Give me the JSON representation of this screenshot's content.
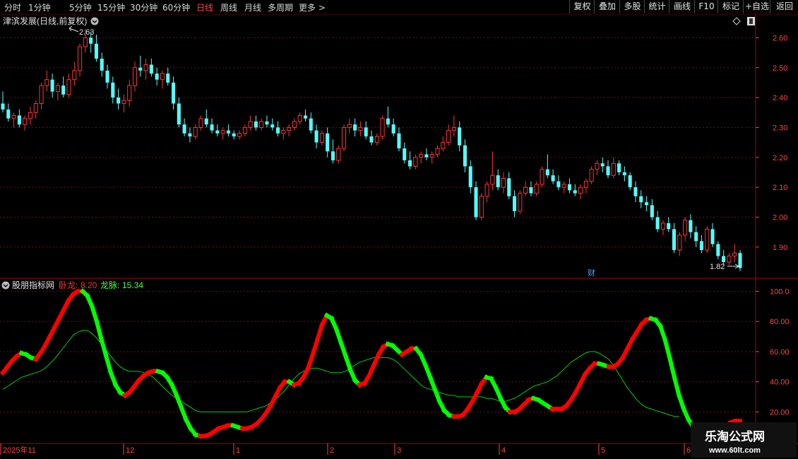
{
  "toolbar": {
    "timeframes": [
      "分时",
      "1分钟",
      "5分钟",
      "15分钟",
      "30分钟",
      "60分钟",
      "日线",
      "周线",
      "月线",
      "多周期",
      "更多 >"
    ],
    "active_index": 6,
    "buttons": [
      "复权",
      "叠加",
      "多股",
      "统计",
      "画线",
      "F10",
      "标记",
      "+自选",
      "返回"
    ]
  },
  "main_chart": {
    "title": "津滨发展(日线,前复权)",
    "high_label": "2.63",
    "low_label": "1.82",
    "finance_marker": "财"
  },
  "indicator": {
    "name": "股朋指标网",
    "wolong_label": "卧龙:",
    "wolong_value": "8.20",
    "longmai_label": "龙脉:",
    "longmai_value": "15.34"
  },
  "watermark": {
    "title": "乐淘公式网",
    "url": "www.60lt.com"
  },
  "colors": {
    "up": "#ff3232",
    "down": "#54ffff",
    "grid": "#8b0000",
    "axis_text": "#ff4040",
    "rising": "#ff0000",
    "falling": "#00ff00",
    "ma_line": "#00d000"
  },
  "chart_data": [
    {
      "type": "candlestick",
      "title": "津滨发展(日线,前复权)",
      "y_ticks": [
        "2.60",
        "2.50",
        "2.40",
        "2.30",
        "2.20",
        "2.10",
        "2.00",
        "1.90"
      ],
      "ylim": [
        1.81,
        2.66
      ],
      "x_labels": [
        "2025年11",
        "12",
        "1",
        "2",
        "3",
        "4",
        "5",
        "6"
      ],
      "candles": [
        [
          2.38,
          2.42,
          2.35,
          2.36
        ],
        [
          2.36,
          2.38,
          2.32,
          2.33
        ],
        [
          2.33,
          2.35,
          2.3,
          2.34
        ],
        [
          2.34,
          2.36,
          2.3,
          2.31
        ],
        [
          2.31,
          2.34,
          2.29,
          2.33
        ],
        [
          2.33,
          2.37,
          2.31,
          2.35
        ],
        [
          2.35,
          2.39,
          2.33,
          2.38
        ],
        [
          2.38,
          2.45,
          2.36,
          2.44
        ],
        [
          2.44,
          2.49,
          2.42,
          2.46
        ],
        [
          2.46,
          2.48,
          2.4,
          2.42
        ],
        [
          2.42,
          2.45,
          2.39,
          2.44
        ],
        [
          2.44,
          2.47,
          2.4,
          2.41
        ],
        [
          2.41,
          2.48,
          2.4,
          2.46
        ],
        [
          2.46,
          2.52,
          2.44,
          2.49
        ],
        [
          2.49,
          2.58,
          2.47,
          2.57
        ],
        [
          2.57,
          2.63,
          2.55,
          2.6
        ],
        [
          2.6,
          2.62,
          2.55,
          2.58
        ],
        [
          2.58,
          2.61,
          2.52,
          2.53
        ],
        [
          2.53,
          2.55,
          2.47,
          2.49
        ],
        [
          2.49,
          2.51,
          2.43,
          2.45
        ],
        [
          2.45,
          2.47,
          2.38,
          2.4
        ],
        [
          2.4,
          2.43,
          2.36,
          2.38
        ],
        [
          2.38,
          2.41,
          2.35,
          2.39
        ],
        [
          2.39,
          2.46,
          2.37,
          2.44
        ],
        [
          2.44,
          2.52,
          2.42,
          2.5
        ],
        [
          2.5,
          2.54,
          2.47,
          2.49
        ],
        [
          2.49,
          2.53,
          2.46,
          2.51
        ],
        [
          2.51,
          2.53,
          2.47,
          2.48
        ],
        [
          2.48,
          2.5,
          2.44,
          2.46
        ],
        [
          2.46,
          2.49,
          2.43,
          2.48
        ],
        [
          2.48,
          2.5,
          2.44,
          2.45
        ],
        [
          2.45,
          2.47,
          2.36,
          2.38
        ],
        [
          2.38,
          2.4,
          2.3,
          2.31
        ],
        [
          2.31,
          2.33,
          2.27,
          2.28
        ],
        [
          2.28,
          2.3,
          2.25,
          2.27
        ],
        [
          2.27,
          2.31,
          2.26,
          2.3
        ],
        [
          2.3,
          2.34,
          2.29,
          2.33
        ],
        [
          2.33,
          2.36,
          2.3,
          2.31
        ],
        [
          2.31,
          2.33,
          2.28,
          2.29
        ],
        [
          2.29,
          2.31,
          2.27,
          2.28
        ],
        [
          2.28,
          2.3,
          2.26,
          2.29
        ],
        [
          2.29,
          2.31,
          2.27,
          2.28
        ],
        [
          2.28,
          2.29,
          2.26,
          2.27
        ],
        [
          2.27,
          2.29,
          2.26,
          2.28
        ],
        [
          2.28,
          2.31,
          2.27,
          2.3
        ],
        [
          2.3,
          2.34,
          2.29,
          2.32
        ],
        [
          2.32,
          2.34,
          2.29,
          2.3
        ],
        [
          2.3,
          2.33,
          2.29,
          2.32
        ],
        [
          2.32,
          2.34,
          2.3,
          2.31
        ],
        [
          2.31,
          2.33,
          2.29,
          2.3
        ],
        [
          2.3,
          2.32,
          2.27,
          2.28
        ],
        [
          2.28,
          2.3,
          2.26,
          2.29
        ],
        [
          2.29,
          2.31,
          2.27,
          2.3
        ],
        [
          2.3,
          2.33,
          2.29,
          2.32
        ],
        [
          2.32,
          2.35,
          2.31,
          2.34
        ],
        [
          2.34,
          2.36,
          2.32,
          2.33
        ],
        [
          2.33,
          2.35,
          2.28,
          2.29
        ],
        [
          2.29,
          2.31,
          2.23,
          2.25
        ],
        [
          2.25,
          2.29,
          2.24,
          2.28
        ],
        [
          2.28,
          2.3,
          2.2,
          2.22
        ],
        [
          2.22,
          2.26,
          2.18,
          2.19
        ],
        [
          2.19,
          2.24,
          2.18,
          2.23
        ],
        [
          2.23,
          2.31,
          2.22,
          2.3
        ],
        [
          2.3,
          2.33,
          2.28,
          2.31
        ],
        [
          2.31,
          2.33,
          2.27,
          2.29
        ],
        [
          2.29,
          2.32,
          2.27,
          2.3
        ],
        [
          2.3,
          2.32,
          2.26,
          2.27
        ],
        [
          2.27,
          2.29,
          2.24,
          2.25
        ],
        [
          2.25,
          2.28,
          2.24,
          2.27
        ],
        [
          2.27,
          2.34,
          2.26,
          2.33
        ],
        [
          2.33,
          2.37,
          2.3,
          2.31
        ],
        [
          2.31,
          2.33,
          2.27,
          2.28
        ],
        [
          2.28,
          2.3,
          2.22,
          2.23
        ],
        [
          2.23,
          2.25,
          2.18,
          2.19
        ],
        [
          2.19,
          2.22,
          2.16,
          2.17
        ],
        [
          2.17,
          2.21,
          2.16,
          2.2
        ],
        [
          2.2,
          2.22,
          2.18,
          2.21
        ],
        [
          2.21,
          2.23,
          2.19,
          2.2
        ],
        [
          2.2,
          2.22,
          2.18,
          2.21
        ],
        [
          2.21,
          2.24,
          2.2,
          2.23
        ],
        [
          2.23,
          2.27,
          2.22,
          2.25
        ],
        [
          2.25,
          2.31,
          2.24,
          2.29
        ],
        [
          2.29,
          2.34,
          2.27,
          2.3
        ],
        [
          2.3,
          2.32,
          2.22,
          2.24
        ],
        [
          2.24,
          2.26,
          2.15,
          2.17
        ],
        [
          2.17,
          2.19,
          2.08,
          2.1
        ],
        [
          2.1,
          2.12,
          1.99,
          2.0
        ],
        [
          2.0,
          2.08,
          1.99,
          2.07
        ],
        [
          2.07,
          2.12,
          2.05,
          2.11
        ],
        [
          2.11,
          2.22,
          2.09,
          2.14
        ],
        [
          2.14,
          2.16,
          2.09,
          2.1
        ],
        [
          2.1,
          2.15,
          2.08,
          2.13
        ],
        [
          2.13,
          2.15,
          2.06,
          2.07
        ],
        [
          2.07,
          2.09,
          2.0,
          2.02
        ],
        [
          2.02,
          2.09,
          2.01,
          2.08
        ],
        [
          2.08,
          2.12,
          2.07,
          2.1
        ],
        [
          2.1,
          2.12,
          2.07,
          2.08
        ],
        [
          2.08,
          2.12,
          2.07,
          2.11
        ],
        [
          2.11,
          2.17,
          2.1,
          2.16
        ],
        [
          2.16,
          2.21,
          2.13,
          2.14
        ],
        [
          2.14,
          2.16,
          2.11,
          2.12
        ],
        [
          2.12,
          2.14,
          2.09,
          2.1
        ],
        [
          2.1,
          2.12,
          2.08,
          2.11
        ],
        [
          2.11,
          2.13,
          2.08,
          2.09
        ],
        [
          2.09,
          2.11,
          2.07,
          2.08
        ],
        [
          2.08,
          2.11,
          2.06,
          2.1
        ],
        [
          2.1,
          2.13,
          2.08,
          2.12
        ],
        [
          2.12,
          2.17,
          2.11,
          2.16
        ],
        [
          2.16,
          2.19,
          2.14,
          2.18
        ],
        [
          2.18,
          2.2,
          2.15,
          2.17
        ],
        [
          2.17,
          2.19,
          2.13,
          2.14
        ],
        [
          2.14,
          2.2,
          2.13,
          2.18
        ],
        [
          2.18,
          2.19,
          2.14,
          2.15
        ],
        [
          2.15,
          2.17,
          2.12,
          2.14
        ],
        [
          2.14,
          2.15,
          2.09,
          2.1
        ],
        [
          2.1,
          2.12,
          2.05,
          2.07
        ],
        [
          2.07,
          2.09,
          2.03,
          2.05
        ],
        [
          2.05,
          2.07,
          2.02,
          2.04
        ],
        [
          2.04,
          2.06,
          1.99,
          2.0
        ],
        [
          2.0,
          2.02,
          1.95,
          1.96
        ],
        [
          1.96,
          1.99,
          1.94,
          1.98
        ],
        [
          1.98,
          2.0,
          1.95,
          1.96
        ],
        [
          1.96,
          1.98,
          1.88,
          1.89
        ],
        [
          1.89,
          1.95,
          1.87,
          1.94
        ],
        [
          1.94,
          2.0,
          1.92,
          1.99
        ],
        [
          1.99,
          2.01,
          1.93,
          1.95
        ],
        [
          1.95,
          1.97,
          1.9,
          1.92
        ],
        [
          1.92,
          1.94,
          1.88,
          1.89
        ],
        [
          1.89,
          1.97,
          1.88,
          1.96
        ],
        [
          1.96,
          1.98,
          1.9,
          1.91
        ],
        [
          1.91,
          1.92,
          1.86,
          1.87
        ],
        [
          1.87,
          1.89,
          1.84,
          1.85
        ],
        [
          1.85,
          1.88,
          1.84,
          1.87
        ],
        [
          1.87,
          1.91,
          1.85,
          1.88
        ],
        [
          1.88,
          1.89,
          1.82,
          1.83
        ]
      ]
    },
    {
      "type": "line",
      "title": "股朋指标网",
      "y_ticks": [
        "100.0",
        "80.00",
        "60.00",
        "40.00",
        "20.00"
      ],
      "ylim": [
        0,
        104
      ],
      "series": [
        {
          "name": "卧龙",
          "values": [
            46,
            50,
            54,
            57,
            59,
            58,
            56,
            55,
            59,
            64,
            70,
            76,
            82,
            88,
            94,
            98,
            100,
            100,
            97,
            90,
            80,
            68,
            57,
            46,
            38,
            33,
            31,
            33,
            37,
            41,
            44,
            46,
            47,
            47,
            46,
            43,
            38,
            31,
            23,
            15,
            9,
            5,
            4,
            4,
            5,
            7,
            9,
            10,
            11,
            11,
            10,
            9,
            9,
            10,
            12,
            15,
            19,
            24,
            30,
            36,
            40,
            40,
            38,
            39,
            43,
            49,
            58,
            68,
            78,
            84,
            82,
            75,
            66,
            57,
            48,
            41,
            38,
            39,
            44,
            51,
            58,
            63,
            65,
            64,
            61,
            58,
            60,
            62,
            62,
            58,
            51,
            43,
            35,
            27,
            21,
            18,
            17,
            17,
            18,
            22,
            27,
            33,
            39,
            43,
            42,
            36,
            29,
            23,
            20,
            20,
            22,
            25,
            28,
            29,
            28,
            26,
            24,
            22,
            22,
            22,
            24,
            28,
            33,
            39,
            45,
            49,
            52,
            52,
            51,
            50,
            50,
            52,
            56,
            62,
            68,
            73,
            78,
            81,
            82,
            81,
            77,
            68,
            56,
            43,
            31,
            22,
            15,
            10,
            7,
            5,
            4,
            4,
            5,
            8,
            11,
            13,
            14,
            14
          ]
        },
        {
          "name": "龙脉",
          "values": [
            35,
            37,
            39,
            41,
            43,
            44,
            45,
            46,
            47,
            49,
            52,
            55,
            59,
            63,
            67,
            71,
            73,
            74,
            74,
            72,
            69,
            65,
            61,
            57,
            53,
            50,
            48,
            47,
            47,
            47,
            46,
            45,
            43,
            40,
            37,
            34,
            31,
            29,
            27,
            25,
            23,
            21,
            20,
            20,
            20,
            20,
            20,
            20,
            20,
            20,
            20,
            20,
            20,
            21,
            22,
            23,
            24,
            26,
            28,
            31,
            34,
            38,
            42,
            45,
            47,
            48,
            49,
            49,
            48,
            47,
            46,
            46,
            46,
            47,
            49,
            51,
            53,
            54,
            55,
            56,
            56,
            56,
            56,
            55,
            53,
            50,
            47,
            44,
            41,
            38,
            36,
            35,
            34,
            33,
            32,
            31,
            31,
            30,
            30,
            30,
            30,
            30,
            30,
            29,
            29,
            28,
            27,
            27,
            28,
            29,
            31,
            33,
            35,
            37,
            38,
            39,
            40,
            42,
            44,
            47,
            50,
            53,
            55,
            57,
            59,
            60,
            60,
            59,
            57,
            55,
            51,
            46,
            41,
            36,
            32,
            28,
            25,
            23,
            22,
            21,
            20,
            19,
            18,
            17,
            17
          ]
        }
      ]
    }
  ]
}
